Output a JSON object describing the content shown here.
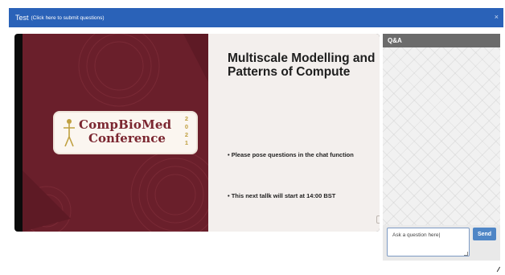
{
  "header": {
    "title": "Test",
    "subtitle": "(Click here to submit questions)",
    "close_symbol": "×"
  },
  "slide": {
    "logo_line1": "CompBioMed",
    "logo_line2": "Conference",
    "logo_year_digits": [
      "2",
      "0",
      "2",
      "1"
    ],
    "title": "Multiscale Modelling and Patterns of Compute",
    "bullet1": "•  Please pose questions in the chat function",
    "bullet2": "•  This next tallk will start at 14:00 BST"
  },
  "qa": {
    "header": "Q&A",
    "input_value": "Ask a question here|",
    "send_label": "Send"
  },
  "colors": {
    "topbar": "#2a62b8",
    "slide_maroon": "#6a1f2b",
    "send_button": "#4f86c6",
    "qa_header": "#6b6b6b"
  }
}
